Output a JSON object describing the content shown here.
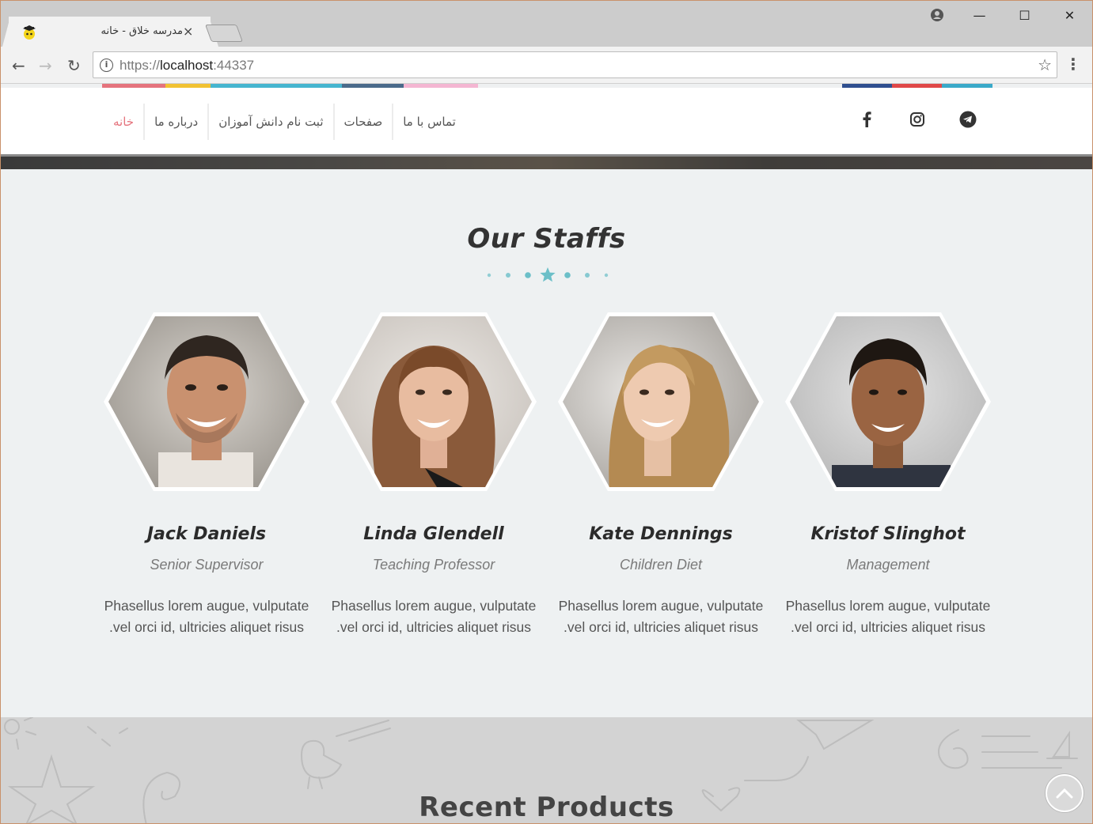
{
  "browser": {
    "tab_title": "مدرسه خلاق - خانه",
    "tab_close": "×",
    "url_scheme": "https://",
    "url_host": "localhost",
    "url_port": ":44337",
    "profile_icon": "profile-icon",
    "minimize": "—",
    "maximize": "☐",
    "close": "✕"
  },
  "header": {
    "nav": [
      {
        "label": "خانه",
        "active": true
      },
      {
        "label": "درباره ما",
        "active": false
      },
      {
        "label": "ثبت نام دانش آموزان",
        "active": false
      },
      {
        "label": "صفحات",
        "active": false
      },
      {
        "label": "تماس با ما",
        "active": false
      }
    ],
    "social": [
      "facebook-icon",
      "instagram-icon",
      "telegram-icon"
    ],
    "strip_colors": [
      "#e5737d",
      "#f1c232",
      "#45b5cf",
      "#4a6a8a",
      "#f4b6d2",
      "#2f4f8f",
      "#e04848",
      "#3aa9c9"
    ]
  },
  "staffs": {
    "title": "Our Staffs",
    "accent": "#6bbfc8",
    "members": [
      {
        "name": "Jack Daniels",
        "role": "Senior Supervisor",
        "desc1": "Phasellus lorem augue, vulputate",
        "desc2": ".vel orci id, ultricies aliquet risus"
      },
      {
        "name": "Linda Glendell",
        "role": "Teaching Professor",
        "desc1": "Phasellus lorem augue, vulputate",
        "desc2": ".vel orci id, ultricies aliquet risus"
      },
      {
        "name": "Kate Dennings",
        "role": "Children Diet",
        "desc1": "Phasellus lorem augue, vulputate",
        "desc2": ".vel orci id, ultricies aliquet risus"
      },
      {
        "name": "Kristof Slinghot",
        "role": "Management",
        "desc1": "Phasellus lorem augue, vulputate",
        "desc2": ".vel orci id, ultricies aliquet risus"
      }
    ]
  },
  "products": {
    "title": "Recent Products"
  }
}
